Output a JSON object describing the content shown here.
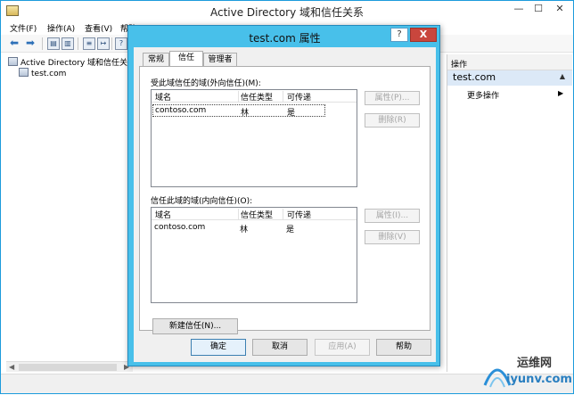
{
  "window": {
    "title": "Active Directory 域和信任关系",
    "min_glyph": "—",
    "max_glyph": "☐",
    "close_glyph": "✕"
  },
  "menu": [
    "文件(F)",
    "操作(A)",
    "查看(V)",
    "帮助(H)"
  ],
  "tree": {
    "root": "Active Directory 域和信任关系",
    "child": "test.com"
  },
  "actions": {
    "header": "操作",
    "section": "test.com",
    "more": "更多操作"
  },
  "dialog": {
    "title": "test.com 属性",
    "help_glyph": "?",
    "close_glyph": "X",
    "tabs": [
      "常规",
      "信任",
      "管理者"
    ],
    "selected_tab": "信任",
    "outgoing": {
      "label": "受此域信任的域(外向信任)(M):",
      "columns": [
        "域名",
        "信任类型",
        "可传递"
      ],
      "rows": [
        {
          "domain": "contoso.com",
          "type": "林",
          "transitive": "是"
        }
      ],
      "properties_btn": "属性(P)...",
      "remove_btn": "删除(R)"
    },
    "incoming": {
      "label": "信任此域的域(内向信任)(O):",
      "columns": [
        "域名",
        "信任类型",
        "可传递"
      ],
      "rows": [
        {
          "domain": "contoso.com",
          "type": "林",
          "transitive": "是"
        }
      ],
      "properties_btn": "属性(I)...",
      "remove_btn": "删除(V)"
    },
    "new_trust_btn": "新建信任(N)...",
    "buttons": {
      "ok": "确定",
      "cancel": "取消",
      "apply": "应用(A)",
      "help": "帮助"
    }
  },
  "watermark": {
    "line1": "运维网",
    "line2": "iyunv.com"
  }
}
